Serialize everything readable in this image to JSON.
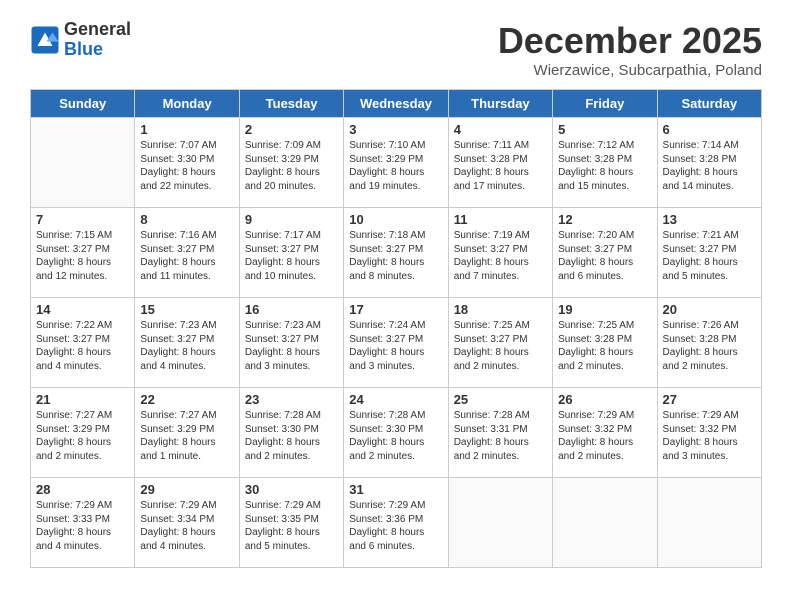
{
  "logo": {
    "general": "General",
    "blue": "Blue"
  },
  "title": "December 2025",
  "subtitle": "Wierzawice, Subcarpathia, Poland",
  "days_of_week": [
    "Sunday",
    "Monday",
    "Tuesday",
    "Wednesday",
    "Thursday",
    "Friday",
    "Saturday"
  ],
  "weeks": [
    [
      {
        "day": "",
        "sunrise": "",
        "sunset": "",
        "daylight": ""
      },
      {
        "day": "1",
        "sunrise": "Sunrise: 7:07 AM",
        "sunset": "Sunset: 3:30 PM",
        "daylight": "Daylight: 8 hours and 22 minutes."
      },
      {
        "day": "2",
        "sunrise": "Sunrise: 7:09 AM",
        "sunset": "Sunset: 3:29 PM",
        "daylight": "Daylight: 8 hours and 20 minutes."
      },
      {
        "day": "3",
        "sunrise": "Sunrise: 7:10 AM",
        "sunset": "Sunset: 3:29 PM",
        "daylight": "Daylight: 8 hours and 19 minutes."
      },
      {
        "day": "4",
        "sunrise": "Sunrise: 7:11 AM",
        "sunset": "Sunset: 3:28 PM",
        "daylight": "Daylight: 8 hours and 17 minutes."
      },
      {
        "day": "5",
        "sunrise": "Sunrise: 7:12 AM",
        "sunset": "Sunset: 3:28 PM",
        "daylight": "Daylight: 8 hours and 15 minutes."
      },
      {
        "day": "6",
        "sunrise": "Sunrise: 7:14 AM",
        "sunset": "Sunset: 3:28 PM",
        "daylight": "Daylight: 8 hours and 14 minutes."
      }
    ],
    [
      {
        "day": "7",
        "sunrise": "Sunrise: 7:15 AM",
        "sunset": "Sunset: 3:27 PM",
        "daylight": "Daylight: 8 hours and 12 minutes."
      },
      {
        "day": "8",
        "sunrise": "Sunrise: 7:16 AM",
        "sunset": "Sunset: 3:27 PM",
        "daylight": "Daylight: 8 hours and 11 minutes."
      },
      {
        "day": "9",
        "sunrise": "Sunrise: 7:17 AM",
        "sunset": "Sunset: 3:27 PM",
        "daylight": "Daylight: 8 hours and 10 minutes."
      },
      {
        "day": "10",
        "sunrise": "Sunrise: 7:18 AM",
        "sunset": "Sunset: 3:27 PM",
        "daylight": "Daylight: 8 hours and 8 minutes."
      },
      {
        "day": "11",
        "sunrise": "Sunrise: 7:19 AM",
        "sunset": "Sunset: 3:27 PM",
        "daylight": "Daylight: 8 hours and 7 minutes."
      },
      {
        "day": "12",
        "sunrise": "Sunrise: 7:20 AM",
        "sunset": "Sunset: 3:27 PM",
        "daylight": "Daylight: 8 hours and 6 minutes."
      },
      {
        "day": "13",
        "sunrise": "Sunrise: 7:21 AM",
        "sunset": "Sunset: 3:27 PM",
        "daylight": "Daylight: 8 hours and 5 minutes."
      }
    ],
    [
      {
        "day": "14",
        "sunrise": "Sunrise: 7:22 AM",
        "sunset": "Sunset: 3:27 PM",
        "daylight": "Daylight: 8 hours and 4 minutes."
      },
      {
        "day": "15",
        "sunrise": "Sunrise: 7:23 AM",
        "sunset": "Sunset: 3:27 PM",
        "daylight": "Daylight: 8 hours and 4 minutes."
      },
      {
        "day": "16",
        "sunrise": "Sunrise: 7:23 AM",
        "sunset": "Sunset: 3:27 PM",
        "daylight": "Daylight: 8 hours and 3 minutes."
      },
      {
        "day": "17",
        "sunrise": "Sunrise: 7:24 AM",
        "sunset": "Sunset: 3:27 PM",
        "daylight": "Daylight: 8 hours and 3 minutes."
      },
      {
        "day": "18",
        "sunrise": "Sunrise: 7:25 AM",
        "sunset": "Sunset: 3:27 PM",
        "daylight": "Daylight: 8 hours and 2 minutes."
      },
      {
        "day": "19",
        "sunrise": "Sunrise: 7:25 AM",
        "sunset": "Sunset: 3:28 PM",
        "daylight": "Daylight: 8 hours and 2 minutes."
      },
      {
        "day": "20",
        "sunrise": "Sunrise: 7:26 AM",
        "sunset": "Sunset: 3:28 PM",
        "daylight": "Daylight: 8 hours and 2 minutes."
      }
    ],
    [
      {
        "day": "21",
        "sunrise": "Sunrise: 7:27 AM",
        "sunset": "Sunset: 3:29 PM",
        "daylight": "Daylight: 8 hours and 2 minutes."
      },
      {
        "day": "22",
        "sunrise": "Sunrise: 7:27 AM",
        "sunset": "Sunset: 3:29 PM",
        "daylight": "Daylight: 8 hours and 1 minute."
      },
      {
        "day": "23",
        "sunrise": "Sunrise: 7:28 AM",
        "sunset": "Sunset: 3:30 PM",
        "daylight": "Daylight: 8 hours and 2 minutes."
      },
      {
        "day": "24",
        "sunrise": "Sunrise: 7:28 AM",
        "sunset": "Sunset: 3:30 PM",
        "daylight": "Daylight: 8 hours and 2 minutes."
      },
      {
        "day": "25",
        "sunrise": "Sunrise: 7:28 AM",
        "sunset": "Sunset: 3:31 PM",
        "daylight": "Daylight: 8 hours and 2 minutes."
      },
      {
        "day": "26",
        "sunrise": "Sunrise: 7:29 AM",
        "sunset": "Sunset: 3:32 PM",
        "daylight": "Daylight: 8 hours and 2 minutes."
      },
      {
        "day": "27",
        "sunrise": "Sunrise: 7:29 AM",
        "sunset": "Sunset: 3:32 PM",
        "daylight": "Daylight: 8 hours and 3 minutes."
      }
    ],
    [
      {
        "day": "28",
        "sunrise": "Sunrise: 7:29 AM",
        "sunset": "Sunset: 3:33 PM",
        "daylight": "Daylight: 8 hours and 4 minutes."
      },
      {
        "day": "29",
        "sunrise": "Sunrise: 7:29 AM",
        "sunset": "Sunset: 3:34 PM",
        "daylight": "Daylight: 8 hours and 4 minutes."
      },
      {
        "day": "30",
        "sunrise": "Sunrise: 7:29 AM",
        "sunset": "Sunset: 3:35 PM",
        "daylight": "Daylight: 8 hours and 5 minutes."
      },
      {
        "day": "31",
        "sunrise": "Sunrise: 7:29 AM",
        "sunset": "Sunset: 3:36 PM",
        "daylight": "Daylight: 8 hours and 6 minutes."
      },
      {
        "day": "",
        "sunrise": "",
        "sunset": "",
        "daylight": ""
      },
      {
        "day": "",
        "sunrise": "",
        "sunset": "",
        "daylight": ""
      },
      {
        "day": "",
        "sunrise": "",
        "sunset": "",
        "daylight": ""
      }
    ]
  ]
}
